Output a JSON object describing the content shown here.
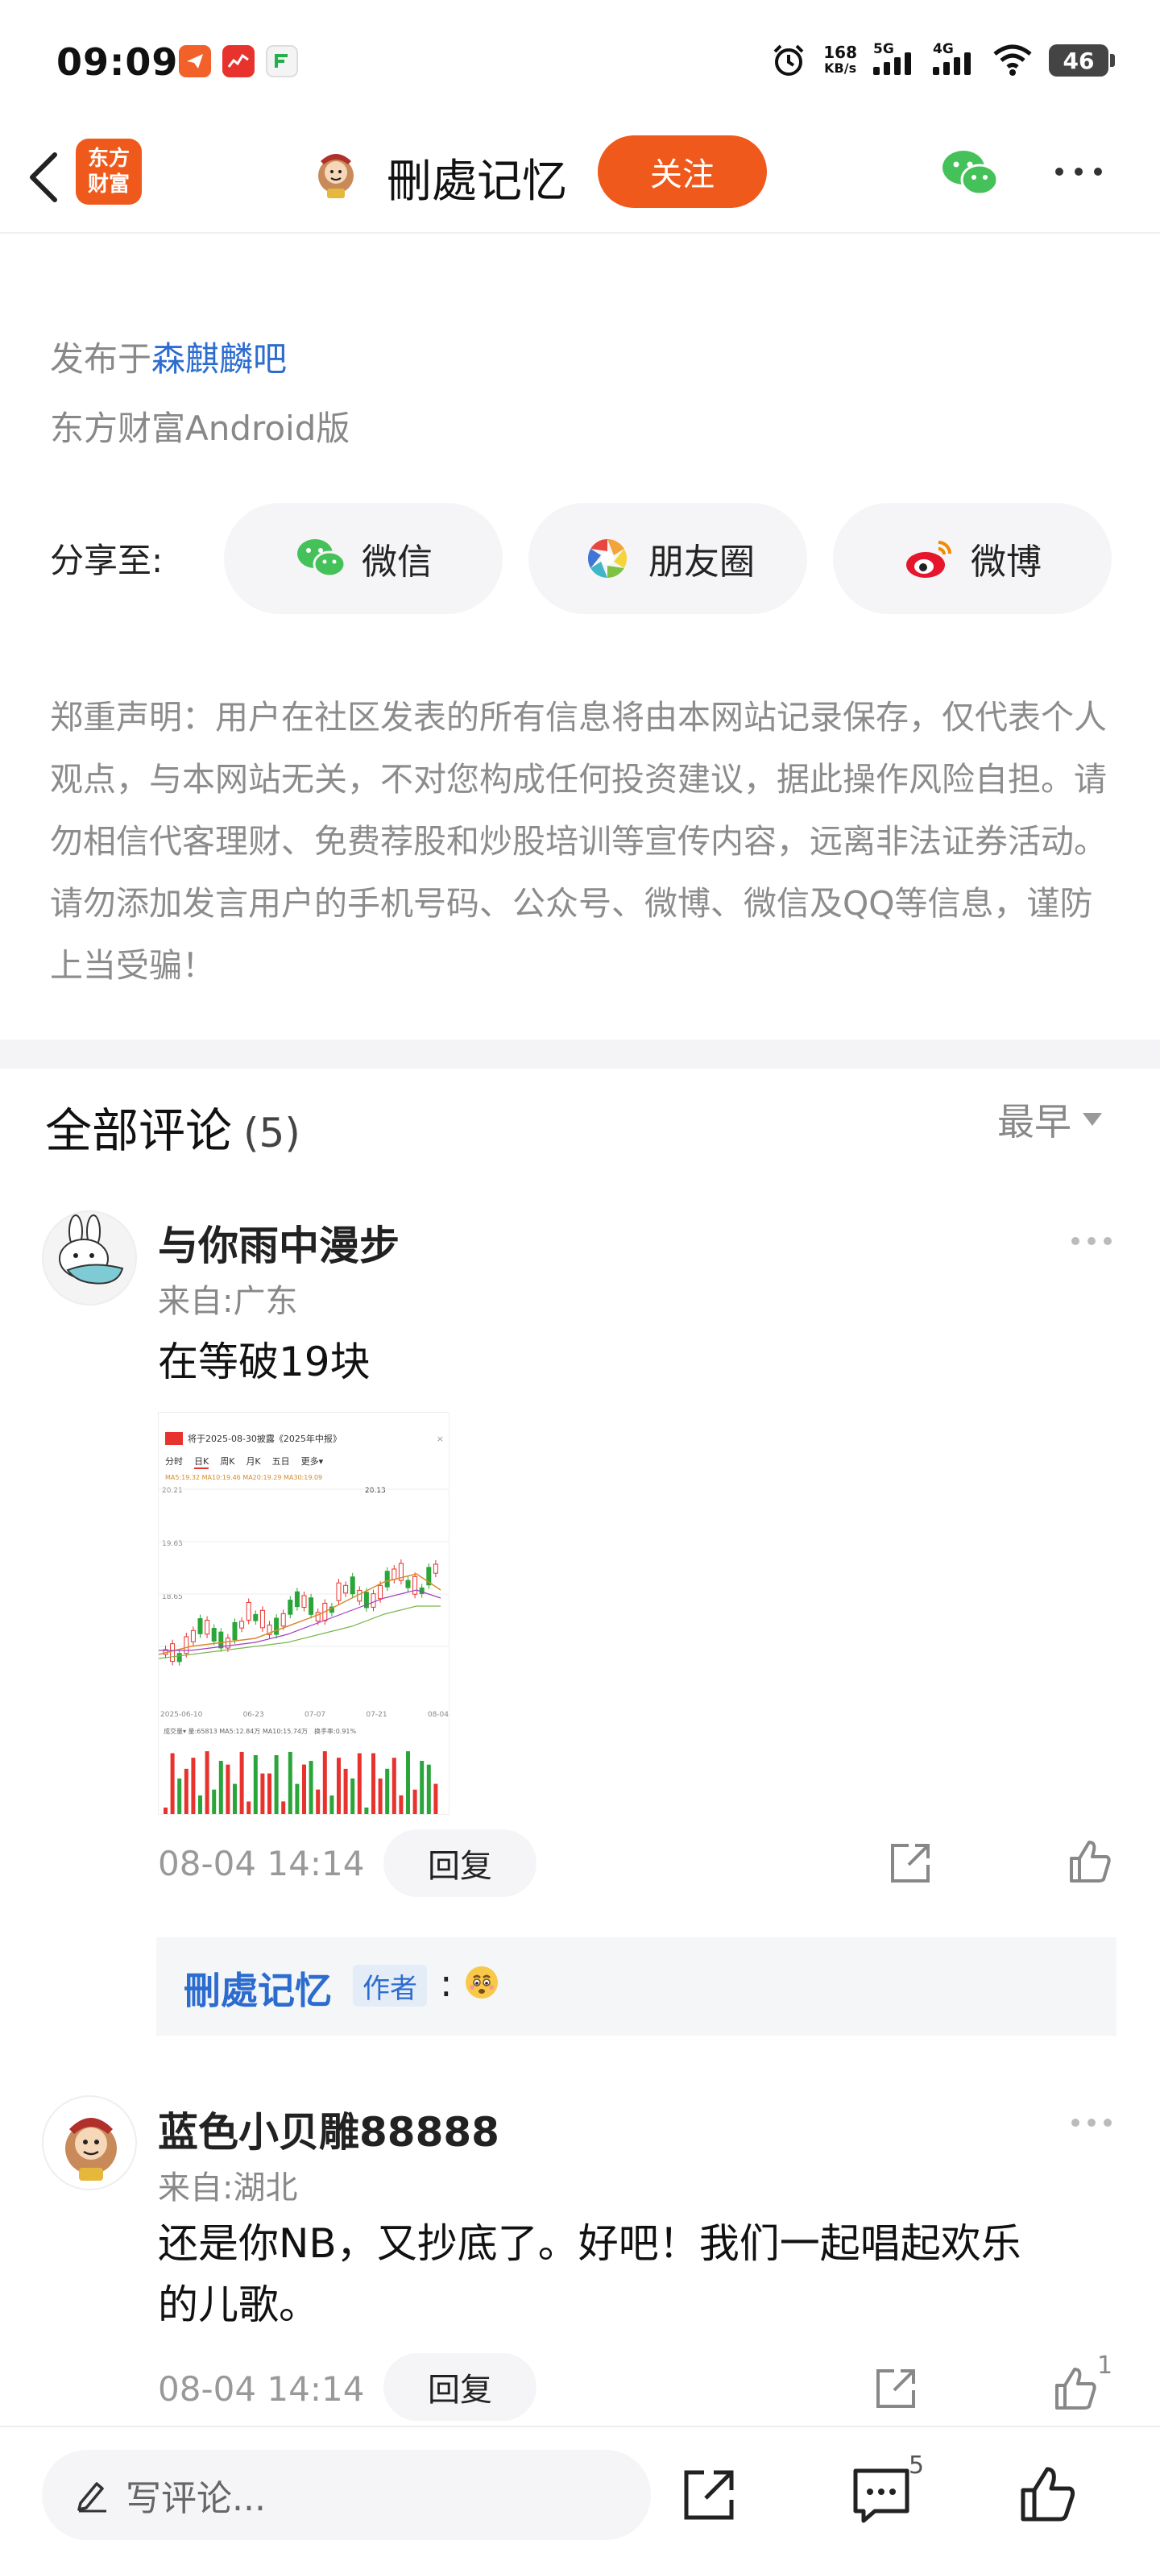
{
  "status_bar": {
    "time": "09:09",
    "net_speed_value": "168",
    "net_speed_unit": "KB/s",
    "signal_1": "5G",
    "signal_2": "4G",
    "battery": "46"
  },
  "header": {
    "brand_line1": "东方",
    "brand_line2": "财富",
    "username": "刪處记忆",
    "follow_label": "关注",
    "brand_color": "#ef5a1c"
  },
  "post": {
    "published_prefix": "发布于",
    "forum_name": "森麒麟吧",
    "client": "东方财富Android版"
  },
  "share": {
    "label": "分享至:",
    "buttons": [
      {
        "label": "微信",
        "icon": "wechat-icon"
      },
      {
        "label": "朋友圈",
        "icon": "moments-icon"
      },
      {
        "label": "微博",
        "icon": "weibo-icon"
      }
    ]
  },
  "disclaimer": "郑重声明：用户在社区发表的所有信息将由本网站记录保存，仅代表个人观点，与本网站无关，不对您构成任何投资建议，据此操作风险自担。请勿相信代客理财、免费荐股和炒股培训等宣传内容，远离非法证券活动。请勿添加发言用户的手机号码、公众号、微博、微信及QQ等信息，谨防上当受骗！",
  "comments_section": {
    "title": "全部评论",
    "count": "(5)",
    "sort_label": "最早"
  },
  "comments": [
    {
      "author": "与你雨中漫步",
      "location": "来自:广东",
      "text": "在等破19块",
      "time": "08-04 14:14",
      "reply_label": "回复",
      "chart_thumbnail": {
        "title": "将于2025-08-30披露《2025年中报》",
        "tabs": [
          "分时",
          "日K",
          "周K",
          "月K",
          "五日",
          "更多▾"
        ],
        "ma_legend": "MA5:19.32  MA10:19.46  MA20:19.29  MA30:19.09",
        "price_high": "20.21",
        "price_mid": "19.63",
        "price_low": "18.65",
        "peak_label": "20.13",
        "dates": [
          "2025-06-10",
          "06-23",
          "07-07",
          "07-21",
          "08-04"
        ],
        "volume_legend": "成交量▾  量:65813  MA5:12.84万  MA10:15.74万",
        "turnover": "换手率:0.91%"
      }
    },
    {
      "author": "蓝色小贝雕88888",
      "location": "来自:湖北",
      "text_line1": "还是你NB，又抄底了。好吧！我们一起唱起欢乐",
      "text_line2": "的儿歌。",
      "time": "08-04 14:14",
      "reply_label": "回复",
      "like_count": "1"
    }
  ],
  "author_reply": {
    "author": "刪處记忆",
    "badge": "作者",
    "colon": ":"
  },
  "bottom_bar": {
    "input_placeholder": "写评论...",
    "comment_count": "5"
  }
}
